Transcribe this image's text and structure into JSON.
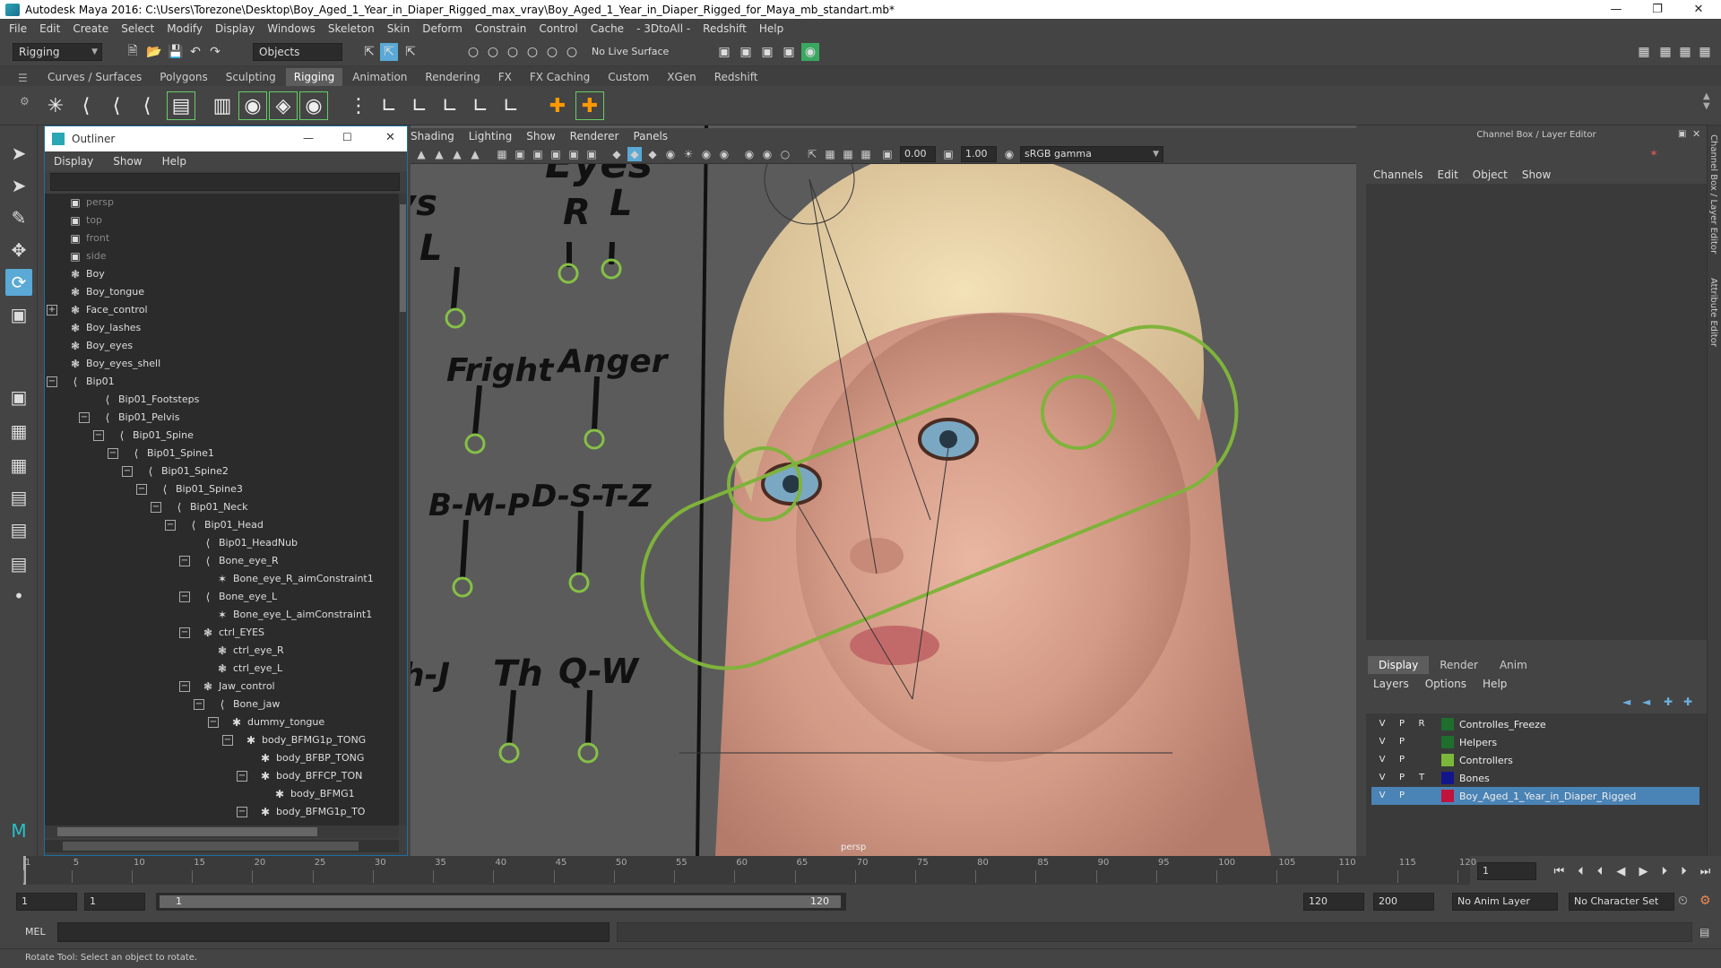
{
  "window": {
    "title": "Autodesk Maya 2016: C:\\Users\\Torezone\\Desktop\\Boy_Aged_1_Year_in_Diaper_Rigged_max_vray\\Boy_Aged_1_Year_in_Diaper_Rigged_for_Maya_mb_standart.mb*"
  },
  "menubar": [
    "File",
    "Edit",
    "Create",
    "Select",
    "Modify",
    "Display",
    "Windows",
    "Skeleton",
    "Skin",
    "Deform",
    "Constrain",
    "Control",
    "Cache",
    "- 3DtoAll -",
    "Redshift",
    "Help"
  ],
  "statusline": {
    "mode": "Rigging",
    "select_mode": "Objects",
    "live_surface": "No Live Surface"
  },
  "shelf_tabs": [
    "Curves / Surfaces",
    "Polygons",
    "Sculpting",
    "Rigging",
    "Animation",
    "Rendering",
    "FX",
    "FX Caching",
    "Custom",
    "XGen",
    "Redshift"
  ],
  "shelf_active": "Rigging",
  "outliner": {
    "title": "Outliner",
    "menu": [
      "Display",
      "Show",
      "Help"
    ],
    "rows": [
      {
        "label": "persp",
        "depth": 0
      },
      {
        "label": "top",
        "depth": 0
      },
      {
        "label": "front",
        "depth": 0
      },
      {
        "label": "side",
        "depth": 0
      },
      {
        "label": "Boy",
        "depth": 0
      },
      {
        "label": "Boy_tongue",
        "depth": 0
      },
      {
        "label": "Face_control",
        "depth": 0
      },
      {
        "label": "Boy_lashes",
        "depth": 0
      },
      {
        "label": "Boy_eyes",
        "depth": 0
      },
      {
        "label": "Boy_eyes_shell",
        "depth": 0
      },
      {
        "label": "Bip01",
        "depth": 0
      },
      {
        "label": "Bip01_Footsteps",
        "depth": 1
      },
      {
        "label": "Bip01_Pelvis",
        "depth": 1
      },
      {
        "label": "Bip01_Spine",
        "depth": 2
      },
      {
        "label": "Bip01_Spine1",
        "depth": 3
      },
      {
        "label": "Bip01_Spine2",
        "depth": 4
      },
      {
        "label": "Bip01_Spine3",
        "depth": 5
      },
      {
        "label": "Bip01_Neck",
        "depth": 6
      },
      {
        "label": "Bip01_Head",
        "depth": 7
      },
      {
        "label": "Bip01_HeadNub",
        "depth": 8
      },
      {
        "label": "Bone_eye_R",
        "depth": 8
      },
      {
        "label": "Bone_eye_R_aimConstraint1",
        "depth": 9
      },
      {
        "label": "Bone_eye_L",
        "depth": 8
      },
      {
        "label": "Bone_eye_L_aimConstraint1",
        "depth": 9
      },
      {
        "label": "ctrl_EYES",
        "depth": 8
      },
      {
        "label": "ctrl_eye_R",
        "depth": 9
      },
      {
        "label": "ctrl_eye_L",
        "depth": 9
      },
      {
        "label": "Jaw_control",
        "depth": 8
      },
      {
        "label": "Bone_jaw",
        "depth": 9
      },
      {
        "label": "dummy_tongue",
        "depth": 10
      },
      {
        "label": "body_BFMG1p_TONG",
        "depth": 11
      },
      {
        "label": "body_BFBP_TONG",
        "depth": 12
      },
      {
        "label": "body_BFFCP_TON",
        "depth": 12
      },
      {
        "label": "body_BFMG1",
        "depth": 13
      },
      {
        "label": "body_BFMG1p_TO",
        "depth": 12
      }
    ]
  },
  "viewport": {
    "menu": [
      "Shading",
      "Lighting",
      "Show",
      "Renderer",
      "Panels"
    ],
    "exposure": "0.00",
    "gamma": "1.00",
    "color_space": "sRGB gamma",
    "camera_label": "persp",
    "face_labels": [
      "Eyes",
      "R",
      "L",
      "vs",
      "L",
      "Fright",
      "Anger",
      "B-M-P",
      "D-S-T-Z",
      "h-J",
      "Th",
      "Q-W"
    ]
  },
  "channelbox": {
    "title": "Channel Box / Layer Editor",
    "menu": [
      "Channels",
      "Edit",
      "Object",
      "Show"
    ],
    "layer_tabs": [
      "Display",
      "Render",
      "Anim"
    ],
    "layer_menu": [
      "Layers",
      "Options",
      "Help"
    ],
    "layers": [
      {
        "v": "V",
        "p": "P",
        "t": "R",
        "name": "Controlles_Freeze",
        "color": "#1f6e2d"
      },
      {
        "v": "V",
        "p": "P",
        "t": "",
        "name": "Helpers",
        "color": "#1f6e2d"
      },
      {
        "v": "V",
        "p": "P",
        "t": "",
        "name": "Controllers",
        "color": "#7bb83a"
      },
      {
        "v": "V",
        "p": "P",
        "t": "T",
        "name": "Bones",
        "color": "#12168a"
      },
      {
        "v": "V",
        "p": "P",
        "t": "",
        "name": "Boy_Aged_1_Year_in_Diaper_Rigged",
        "color": "#c0143c"
      }
    ],
    "side_tabs": [
      "Channel Box / Layer Editor",
      "Attribute Editor"
    ]
  },
  "timeslider": {
    "ticks": [
      "1",
      "5",
      "10",
      "15",
      "20",
      "25",
      "30",
      "35",
      "40",
      "45",
      "50",
      "55",
      "60",
      "65",
      "70",
      "75",
      "80",
      "85",
      "90",
      "95",
      "100",
      "105",
      "110",
      "115",
      "120"
    ],
    "current_frame": "1"
  },
  "range": {
    "start": "1",
    "start2": "1",
    "slider_start": "1",
    "slider_end": "120",
    "end": "120",
    "end2": "200",
    "anim_layer": "No Anim Layer",
    "char_set": "No Character Set"
  },
  "cmdline": {
    "label": "MEL"
  },
  "helpline": {
    "text": "Rotate Tool: Select an object to rotate."
  }
}
